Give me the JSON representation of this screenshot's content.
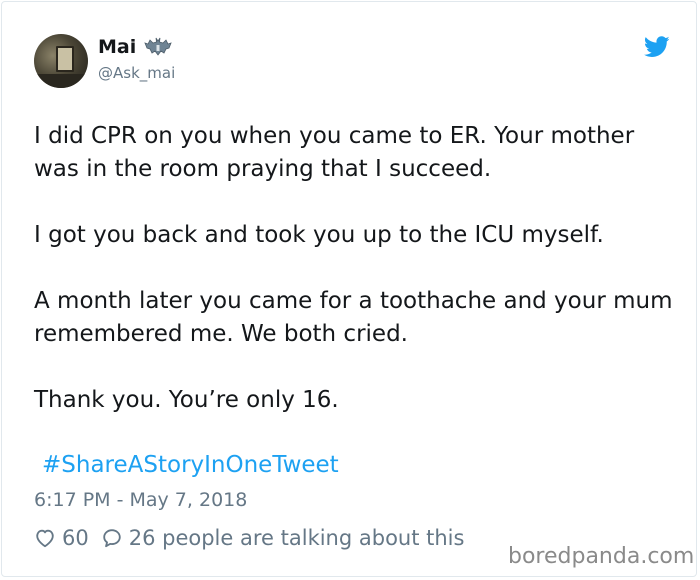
{
  "tweet": {
    "author_name": "Mai",
    "author_handle": "@Ask_mai",
    "paragraphs": [
      "I did CPR on you when you came to ER. Your mother was in the room praying that I succeed.",
      "I got you back and took you up to the ICU myself.",
      "A month later you came for a toothache and your mum remembered me. We both cried.",
      "Thank you. You’re only 16."
    ],
    "hashtag": "#ShareAStoryInOneTweet",
    "timestamp": "6:17 PM - May 7, 2018",
    "likes": "60",
    "talking_text": "26 people are talking about this"
  },
  "icons": {
    "name_badge": "bat-icon",
    "platform": "twitter-bird-icon",
    "like": "heart-icon",
    "reply": "speech-bubble-icon"
  },
  "colors": {
    "link": "#1da1f2",
    "muted": "#657786",
    "text": "#14171a"
  },
  "watermark": "boredpanda.com"
}
